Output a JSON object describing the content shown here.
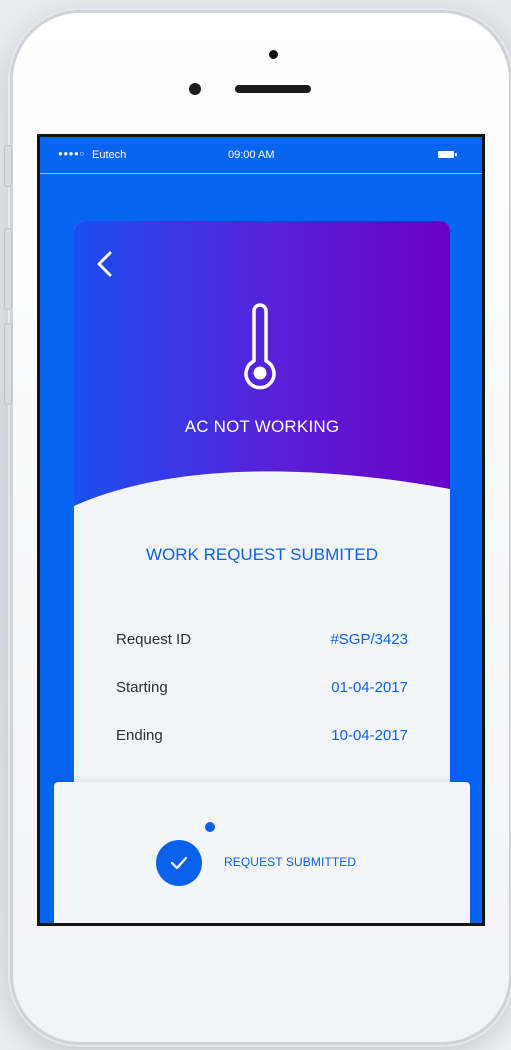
{
  "status_bar": {
    "signal": "●●●●○",
    "carrier": "Eutech",
    "time": "09:00 AM"
  },
  "card": {
    "back_icon": "chevron-left-icon",
    "issue_icon": "thermometer-icon",
    "issue_title": "AC NOT WORKING",
    "submitted_heading": "WORK REQUEST SUBMITED",
    "details": [
      {
        "label": "Request ID",
        "value": "#SGP/3423"
      },
      {
        "label": "Starting",
        "value": "01-04-2017"
      },
      {
        "label": "Ending",
        "value": "10-04-2017"
      }
    ]
  },
  "bottom_panel": {
    "status_icon": "check-icon",
    "status_label": "REQUEST SUBMITTED"
  },
  "colors": {
    "screen_background": "#0564f0",
    "header_gradient_start": "#1a4ff0",
    "header_gradient_end": "#6a00c6",
    "accent": "#0a62ea",
    "card_background": "#f4f5f9"
  }
}
